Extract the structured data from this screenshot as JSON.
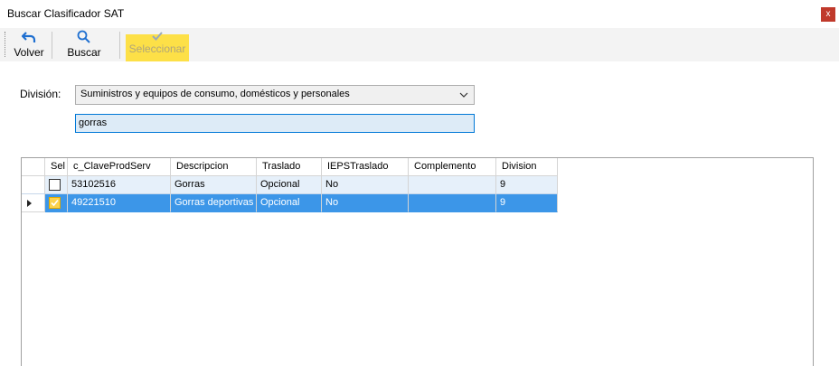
{
  "window": {
    "title": "Buscar Clasificador SAT",
    "close_label": "x"
  },
  "toolbar": {
    "back_label": "Volver",
    "search_label": "Buscar",
    "select_label": "Seleccionar"
  },
  "form": {
    "division_label": "División:",
    "division_value": "Suministros y equipos de consumo, domésticos y personales",
    "search_value": "gorras"
  },
  "grid": {
    "columns": [
      "Sel",
      "c_ClaveProdServ",
      "Descripcion",
      "Traslado",
      "IEPSTraslado",
      "Complemento",
      "Division"
    ],
    "rows": [
      {
        "sel": false,
        "clave": "53102516",
        "descripcion": "Gorras",
        "traslado": "Opcional",
        "ieps": "No",
        "complemento": "",
        "division": "9"
      },
      {
        "sel": true,
        "clave": "49221510",
        "descripcion": "Gorras deportivas",
        "traslado": "Opcional",
        "ieps": "No",
        "complemento": "",
        "division": "9"
      }
    ]
  },
  "colors": {
    "accent": "#0078d7",
    "selected_row": "#3c96e8",
    "highlight": "#fde047",
    "close": "#c0392b"
  },
  "icons": [
    "undo-arrow-icon",
    "magnifier-icon",
    "checkmark-icon",
    "chevron-down-icon",
    "row-caret-icon"
  ]
}
